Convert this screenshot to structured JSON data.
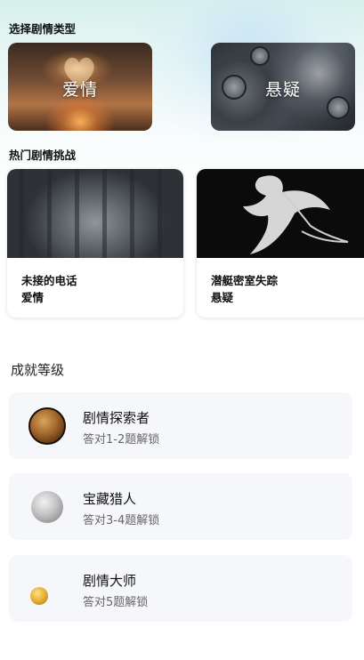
{
  "sections": {
    "types_title": "选择剧情类型",
    "hot_title": "热门剧情挑战",
    "achieve_title": "成就等级"
  },
  "types": [
    {
      "label": "爱情",
      "icon": "heart-hands-image"
    },
    {
      "label": "悬疑",
      "icon": "clock-staircase-image"
    }
  ],
  "hot": [
    {
      "title": "未接的电话",
      "tag": "爱情",
      "image": "foggy-forest-image"
    },
    {
      "title": "潜艇密室失踪",
      "tag": "悬疑",
      "image": "dancer-image"
    }
  ],
  "achievements": [
    {
      "name": "剧情探索者",
      "desc": "答对1-2题解锁",
      "icon": "bronze-coin-icon",
      "color": "#8a5a2b"
    },
    {
      "name": "宝藏猎人",
      "desc": "答对3-4题解锁",
      "icon": "silver-coin-icon",
      "color": "#b8b8b8"
    },
    {
      "name": "剧情大师",
      "desc": "答对5题解锁",
      "icon": "gold-coin-icon",
      "color": "#d4a020"
    }
  ]
}
